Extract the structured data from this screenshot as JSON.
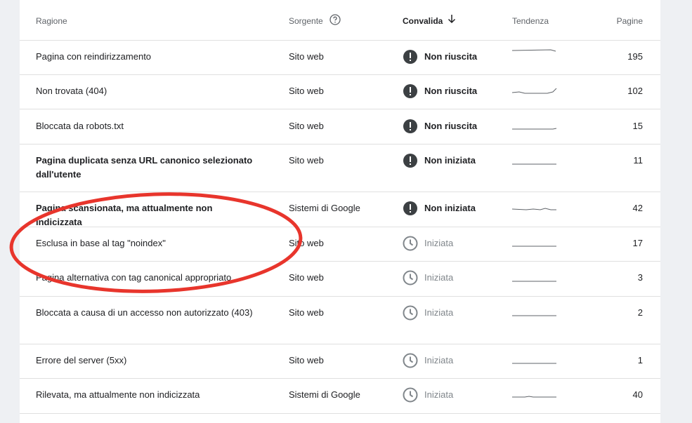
{
  "table": {
    "headers": {
      "reason": "Ragione",
      "source": "Sorgente",
      "validation": "Convalida",
      "trend": "Tendenza",
      "pages": "Pagine"
    },
    "rows": [
      {
        "reason": "Pagina con reindirizzamento",
        "source": "Sito web",
        "status": "Non riuscita",
        "pages": "195",
        "bold": false
      },
      {
        "reason": "Non trovata (404)",
        "source": "Sito web",
        "status": "Non riuscita",
        "pages": "102",
        "bold": false
      },
      {
        "reason": "Bloccata da robots.txt",
        "source": "Sito web",
        "status": "Non riuscita",
        "pages": "15",
        "bold": false
      },
      {
        "reason": "Pagina duplicata senza URL canonico selezionato dall'utente",
        "source": "Sito web",
        "status": "Non iniziata",
        "pages": "11",
        "bold": true
      },
      {
        "reason": "Pagina scansionata, ma attualmente non indicizzata",
        "source": "Sistemi di Google",
        "status": "Non iniziata",
        "pages": "42",
        "bold": true
      },
      {
        "reason": "Esclusa in base al tag \"noindex\"",
        "source": "Sito web",
        "status": "Iniziata",
        "pages": "17",
        "bold": false
      },
      {
        "reason": "Pagina alternativa con tag canonical appropriato",
        "source": "Sito web",
        "status": "Iniziata",
        "pages": "3",
        "bold": false
      },
      {
        "reason": "Bloccata a causa di un accesso non autorizzato (403)",
        "source": "Sito web",
        "status": "Iniziata",
        "pages": "2",
        "bold": false
      },
      {
        "reason": "Errore del server (5xx)",
        "source": "Sito web",
        "status": "Iniziata",
        "pages": "1",
        "bold": false
      },
      {
        "reason": "Rilevata, ma attualmente non indicizzata",
        "source": "Sistemi di Google",
        "status": "Iniziata",
        "pages": "40",
        "bold": false
      }
    ]
  },
  "icons": {
    "help": "help-circle-icon",
    "sort": "arrow-down-icon",
    "failed": "error-icon",
    "started": "clock-icon"
  },
  "colors": {
    "error_icon": "#3c4043",
    "started_icon": "#80868b",
    "annotation": "#e8352c",
    "sparkline": "#5f6368"
  }
}
